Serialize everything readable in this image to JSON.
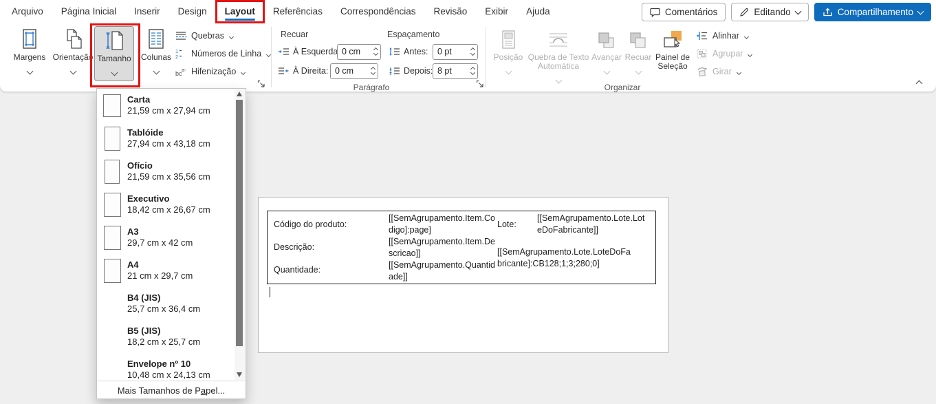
{
  "menu": {
    "tabs": [
      {
        "label": "Arquivo",
        "active": false,
        "annotated": false
      },
      {
        "label": "Página Inicial",
        "active": false,
        "annotated": false
      },
      {
        "label": "Inserir",
        "active": false,
        "annotated": false
      },
      {
        "label": "Design",
        "active": false,
        "annotated": false
      },
      {
        "label": "Layout",
        "active": true,
        "annotated": true
      },
      {
        "label": "Referências",
        "active": false,
        "annotated": false
      },
      {
        "label": "Correspondências",
        "active": false,
        "annotated": false
      },
      {
        "label": "Revisão",
        "active": false,
        "annotated": false
      },
      {
        "label": "Exibir",
        "active": false,
        "annotated": false
      },
      {
        "label": "Ajuda",
        "active": false,
        "annotated": false
      }
    ],
    "comments_label": "Comentários",
    "editing_label": "Editando",
    "share_label": "Compartilhamento"
  },
  "ribbon": {
    "page_setup": {
      "margins": "Margens",
      "orientation": "Orientação",
      "size": "Tamanho",
      "columns": "Colunas",
      "breaks": "Quebras",
      "line_numbers": "Números de Linha",
      "hyphenation": "Hifenização"
    },
    "paragraph": {
      "title": "Parágrafo",
      "indent_label": "Recuar",
      "left_label": "À Esquerda:",
      "left_value": "0 cm",
      "right_label": "À Direita:",
      "right_value": "0 cm",
      "spacing_label": "Espaçamento",
      "before_label": "Antes:",
      "before_value": "0 pt",
      "after_label": "Depois:",
      "after_value": "8 pt"
    },
    "arrange": {
      "title": "Organizar",
      "position": "Posição",
      "wrap_text": "Quebra de Texto Automática",
      "bring_forward": "Avançar",
      "send_backward": "Recuar",
      "selection_pane": "Painel de Seleção",
      "align": "Alinhar",
      "group": "Agrupar",
      "rotate": "Girar"
    }
  },
  "size_menu": {
    "items": [
      {
        "name": "Carta",
        "size": "21,59 cm x 27,94 cm",
        "icon": true
      },
      {
        "name": "Tablóide",
        "size": "27,94 cm x 43,18 cm",
        "icon": true
      },
      {
        "name": "Ofício",
        "size": "21,59 cm x 35,56 cm",
        "icon": true
      },
      {
        "name": "Executivo",
        "size": "18,42 cm x 26,67 cm",
        "icon": true
      },
      {
        "name": "A3",
        "size": "29,7 cm x 42 cm",
        "icon": true
      },
      {
        "name": "A4",
        "size": "21 cm x 29,7 cm",
        "icon": true
      },
      {
        "name": "B4 (JIS)",
        "size": "25,7 cm x 36,4 cm",
        "icon": false
      },
      {
        "name": "B5 (JIS)",
        "size": "18,2 cm x 25,7 cm",
        "icon": false
      },
      {
        "name": "Envelope nº 10",
        "size": "10,48 cm x 24,13 cm",
        "icon": false
      }
    ],
    "footer": {
      "prefix": "Mais Tamanhos de P",
      "accesskey": "a",
      "suffix": "pel..."
    }
  },
  "document": {
    "product_code_label": "Código do produto:",
    "product_code_value": "[[SemAgrupamento.Item.Codigo]:page]",
    "description_label": "Descrição:",
    "description_value": "[[SemAgrupamento.Item.Descricao]]",
    "quantity_label": "Quantidade:",
    "quantity_value": "[[SemAgrupamento.Quantidade]]",
    "lot_label": "Lote:",
    "lot_value": "[[SemAgrupamento.Lote.LoteDoFabricante]]",
    "lot_barcode_value": "[[SemAgrupamento.Lote.LoteDoFabricante]:CB128;1;3;280;0]"
  },
  "colors": {
    "accent_blue": "#0f6cbd",
    "annotation_red": "#e11414",
    "selection_orange": "#f0a84c",
    "workspace_gray": "#efefef"
  }
}
